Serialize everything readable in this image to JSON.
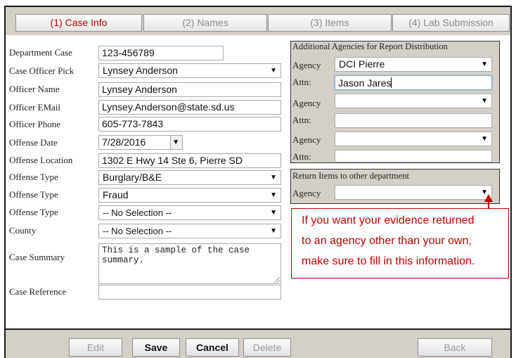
{
  "tabs": [
    {
      "label": "(1) Case Info",
      "active": true
    },
    {
      "label": "(2) Names",
      "active": false
    },
    {
      "label": "(3) Items",
      "active": false
    },
    {
      "label": "(4) Lab Submission",
      "active": false
    }
  ],
  "form": {
    "department_case": {
      "label": "Department Case",
      "value": "123-456789"
    },
    "case_officer_pick": {
      "label": "Case Officer Pick",
      "value": "Lynsey Anderson"
    },
    "officer_name": {
      "label": "Officer Name",
      "value": "Lynsey Anderson"
    },
    "officer_email": {
      "label": "Officer EMail",
      "value": "Lynsey.Anderson@state.sd.us"
    },
    "officer_phone": {
      "label": "Officer Phone",
      "value": "605-773-7843"
    },
    "offense_date": {
      "label": "Offense Date",
      "value": "7/28/2016"
    },
    "offense_location": {
      "label": "Offense Location",
      "value": "1302 E Hwy 14 Ste 6, Pierre SD"
    },
    "offense_type_1": {
      "label": "Offense Type",
      "value": "Burglary/B&E"
    },
    "offense_type_2": {
      "label": "Offense Type",
      "value": "Fraud"
    },
    "offense_type_3": {
      "label": "Offense Type",
      "value": "-- No Selection --"
    },
    "county": {
      "label": "County",
      "value": "-- No Selection --"
    },
    "case_summary": {
      "label": "Case Summary",
      "value": "This is a sample of the case summary."
    },
    "case_reference": {
      "label": "Case Reference",
      "value": ""
    }
  },
  "additional_agencies": {
    "title": "Additional Agencies for Report Distribution",
    "agency_label": "Agency",
    "attn_label": "Attn:",
    "entries": [
      {
        "agency": "DCI Pierre",
        "attn": "Jason Jares"
      },
      {
        "agency": "",
        "attn": ""
      },
      {
        "agency": "",
        "attn": ""
      }
    ]
  },
  "return_items": {
    "title": "Return Items to other department",
    "agency_label": "Agency",
    "agency": ""
  },
  "callout": {
    "lines": [
      "If you want your evidence returned",
      "to an agency other than your own,",
      "make sure to fill in this information."
    ]
  },
  "buttons": {
    "edit": "Edit",
    "save": "Save",
    "cancel": "Cancel",
    "delete": "Delete",
    "back": "Back"
  },
  "icons": {
    "dropdown": "chevron-down-icon",
    "calendar": "date-picker-icon",
    "resize": "resize-grip-icon",
    "callout_pointer": "arrow-up-icon"
  },
  "colors": {
    "active_tab": "#c00000",
    "callout": "#c00000",
    "panel_bg": "#d4d0c8"
  }
}
